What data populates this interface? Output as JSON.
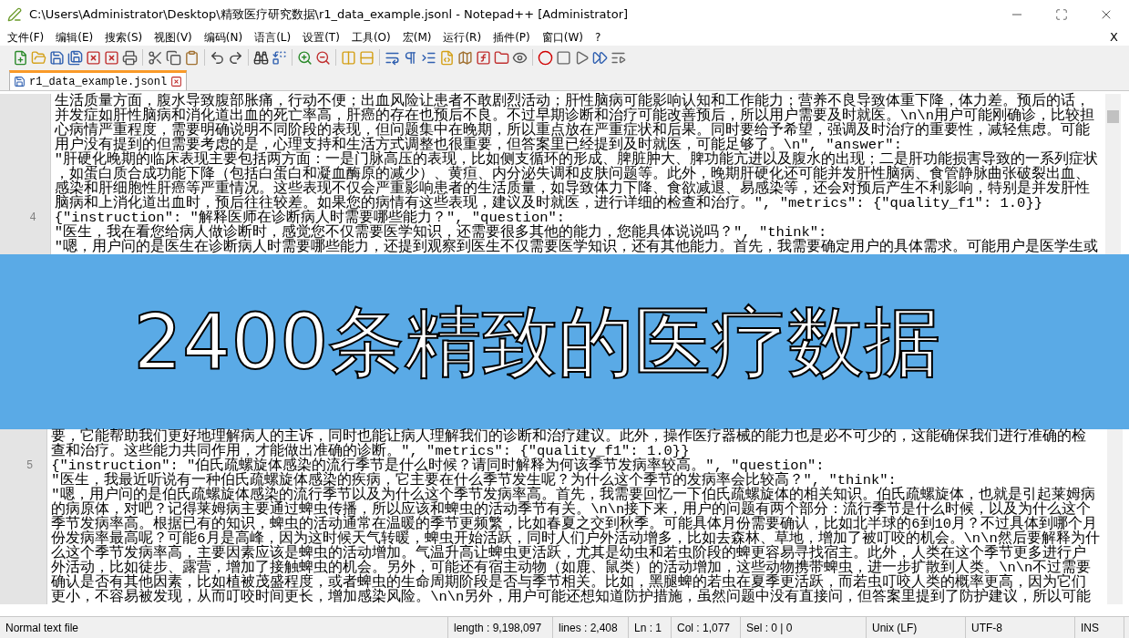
{
  "window": {
    "title": "C:\\Users\\Administrator\\Desktop\\精致医疗研究数据\\r1_data_example.jsonl - Notepad++ [Administrator]"
  },
  "menu": [
    "文件(F)",
    "编辑(E)",
    "搜索(S)",
    "视图(V)",
    "编码(N)",
    "语言(L)",
    "设置(T)",
    "工具(O)",
    "宏(M)",
    "运行(R)",
    "插件(P)",
    "窗口(W)",
    "?"
  ],
  "menu_close": "X",
  "tabs": [
    {
      "label": "r1_data_example.jsonl",
      "selected": true
    }
  ],
  "editor": {
    "lines_above": [
      {
        "parts": [
          "生活质量方面，腹水导致腹部胀痛，行动不便；出血风险让患者不敢剧烈活动；肝性脑病可能影响认知和工作能力；营养不良导致体重下降，体力差。预后的话，"
        ]
      },
      {
        "parts": [
          "并发症如肝性脑病和消化道出血的死亡率高，肝癌的存在也预后不良。不过早期诊断和治疗可能改善预后，所以用户需要及时就医。\\n\\n用户可能刚确诊，比较担"
        ]
      },
      {
        "parts": [
          "心病情严重程度，需要明确说明不同阶段的表现，但问题集中在晚期，所以重点放在严重症状和后果。同时要给予希望，强调及时治疗的重要性，减轻焦虑。可能"
        ]
      },
      {
        "parts": [
          "用户没有提到的但需要考虑的是，心理支持和生活方式调整也很重要，但答案里已经提到及时就医，可能足够了。\\n\", \"answer\":"
        ]
      },
      {
        "parts": [
          "\"肝硬化晚期的临床表现主要包括两方面：一是门脉高压的表现，比如侧支循环的形成、脾脏肿大、脾功能亢进以及腹水的出现；二是肝功能损害导致的一系列症状"
        ]
      },
      {
        "parts": [
          "，如蛋白质合成功能下降（包括白蛋白和凝血酶原的减少）、黄疸、内分泌失调和皮肤问题等。此外，晚期肝硬化还可能并发肝性脑病、食管静脉曲张破裂出血、"
        ]
      },
      {
        "parts": [
          "感染和肝细胞性肝癌等严重情况。这些表现不仅会严重影响患者的生活质量，如导致体力下降、食欲减退、易感染等，还会对预后产生不利影响，特别是并发肝性"
        ]
      },
      {
        "parts": [
          "脑病和上消化道出血时，预后往往较差。如果您的病情有这些表现，建议及时就医，进行详细的检查和治疗。\", \"metrics\": {\"quality_f1\": 1.0}}"
        ]
      },
      {
        "number": "4",
        "parts": [
          "{\"instruction\": \"解释医师在诊断病人时需要哪些能力？\", \"question\":"
        ]
      },
      {
        "parts": [
          "\"医生，我在看您给病人做诊断时，感觉您不仅需要医学知识，还需要很多其他的能力，您能具体说说吗？\", \"think\":"
        ]
      },
      {
        "parts": [
          "\"嗯，用户问的是医生在诊断病人时需要哪些能力，还提到观察到医生不仅需要医学知识，还有其他能力。首先，我需要确定用户的具体需求。可能用户是医学生或"
        ]
      }
    ],
    "lines_below": [
      {
        "parts": [
          "要，它能帮助我们更好地理解病人的主诉，同时也能让病人理解我们的诊断和治疗建议。此外，操作医疗器械的能力也是必不可少的，这能确保我们进行准确的检"
        ]
      },
      {
        "parts": [
          "查和治疗。这些能力共同作用，才能做出准确的诊断。\", \"metrics\": {\"quality_f1\": 1.0}}"
        ]
      },
      {
        "number": "5",
        "parts": [
          "{\"instruction\": \"伯氏疏螺旋体感染的流行季节是什么时候？请同时解释为何该季节发病率较高。\", \"question\":"
        ]
      },
      {
        "parts": [
          "\"医生，我最近听说有一种伯氏疏螺旋体感染的疾病，它主要在什么季节发生呢？为什么这个季节的发病率会比较高？\", \"think\":"
        ]
      },
      {
        "parts": [
          "\"嗯，用户问的是伯氏疏螺旋体感染的流行季节以及为什么这个季节发病率高。首先，我需要回忆一下伯氏疏螺旋体的相关知识。伯氏疏螺旋体，也就是引起莱姆病"
        ]
      },
      {
        "parts": [
          "的病原体，对吧？记得莱姆病主要通过蜱虫传播，所以应该和蜱虫的活动季节有关。\\n\\n接下来，用户的问题有两个部分：流行季节是什么时候，以及为什么这个"
        ]
      },
      {
        "parts": [
          "季节发病率高。根据已有的知识，蜱虫的活动通常在温暖的季节更频繁，比如春夏之交到秋季。可能具体月份需要确认，比如北半球的6到10月？不过具体到哪个月"
        ]
      },
      {
        "parts": [
          "份发病率最高呢？可能6月是高峰，因为这时候天气转暖，蜱虫开始活跃，同时人们户外活动增多，比如去森林、草地，增加了被叮咬的机会。\\n\\n然后要解释为什"
        ]
      },
      {
        "parts": [
          "么这个季节发病率高，主要因素应该是蜱虫的活动增加。气温升高让蜱虫更活跃，尤其是幼虫和若虫阶段的蜱更容易寻找宿主。此外，人类在这个季节更多进行户"
        ]
      },
      {
        "parts": [
          "外活动，比如徒步、露营，增加了接触蜱虫的机会。另外，可能还有宿主动物（如鹿、鼠类）的活动增加，这些动物携带蜱虫，进一步扩散到人类。\\n\\n不过需要"
        ]
      },
      {
        "parts": [
          "确认是否有其他因素，比如植被茂盛程度，或者蜱虫的生命周期阶段是否与季节相关。比如，黑腿蜱的若虫在夏季更活跃，而若虫叮咬人类的概率更高，因为它们"
        ]
      },
      {
        "parts": [
          "更小，不容易被发现，从而叮咬时间更长，增加感染风险。\\n\\n另外，用户可能还想知道防护措施，虽然问题中没有直接问，但答案里提到了防护建议，所以可能"
        ]
      }
    ]
  },
  "banner": {
    "text": "2400条精致的医疗数据"
  },
  "status_bar": [
    "Normal text file",
    "length : 9,198,097",
    "lines : 2,408",
    "Ln : 1",
    "Col : 1,077",
    "Sel : 0 | 0",
    "Unix (LF)",
    "UTF-8",
    "INS"
  ]
}
